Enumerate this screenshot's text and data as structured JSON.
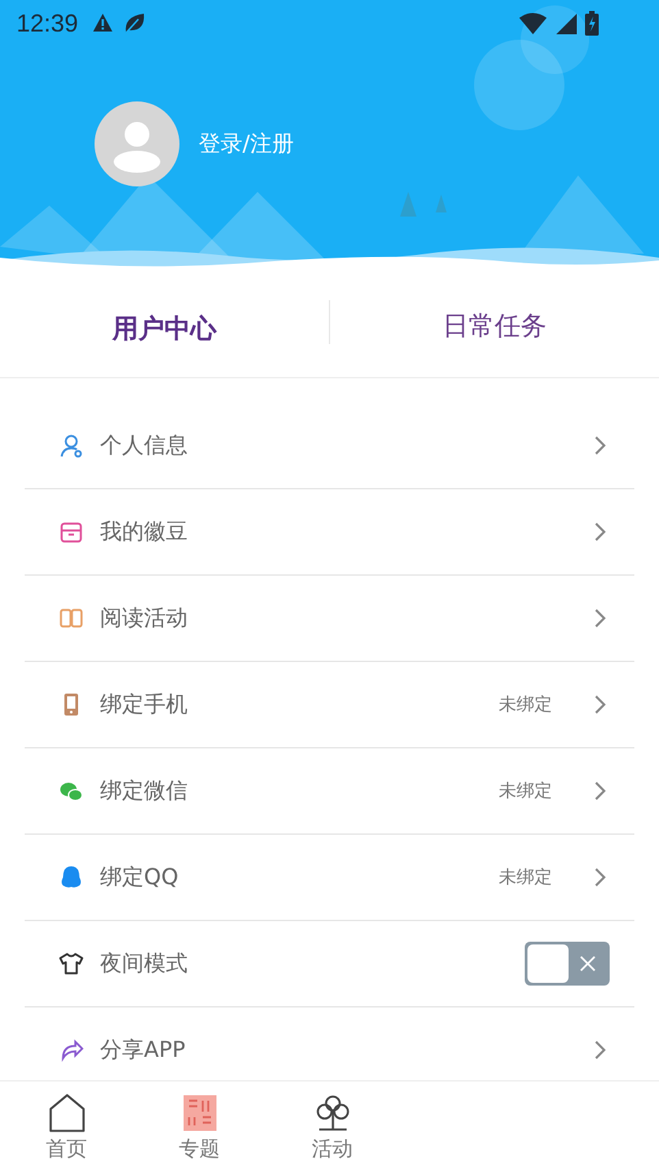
{
  "status_bar": {
    "time": "12:39"
  },
  "profile": {
    "login_label": "登录/注册"
  },
  "tabs": [
    {
      "label": "用户中心",
      "selected": true
    },
    {
      "label": "日常任务",
      "selected": false
    }
  ],
  "menu": [
    {
      "kind": "link",
      "label": "个人信息"
    },
    {
      "kind": "link",
      "label": "我的徽豆"
    },
    {
      "kind": "link",
      "label": "阅读活动"
    },
    {
      "kind": "link",
      "label": "绑定手机",
      "value": "未绑定"
    },
    {
      "kind": "link",
      "label": "绑定微信",
      "value": "未绑定"
    },
    {
      "kind": "link",
      "label": "绑定QQ",
      "value": "未绑定"
    },
    {
      "kind": "toggle",
      "label": "夜间模式",
      "on": false
    },
    {
      "kind": "link",
      "label": "分享APP"
    }
  ],
  "bottom_nav": [
    {
      "label": "首页"
    },
    {
      "label": "专题"
    },
    {
      "label": "活动"
    }
  ]
}
